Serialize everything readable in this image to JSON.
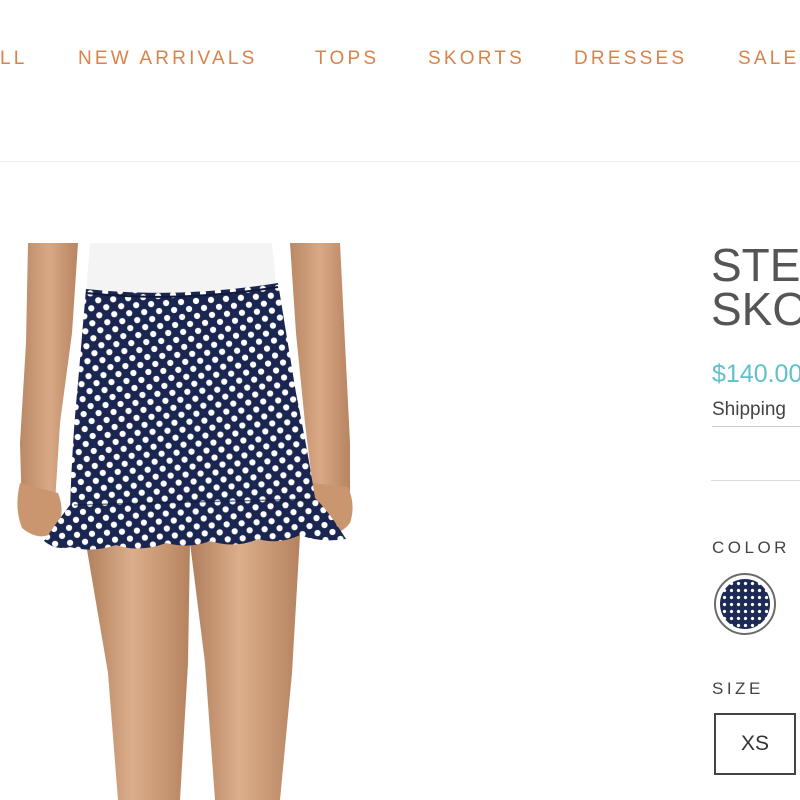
{
  "nav": {
    "items": [
      {
        "label": "LL"
      },
      {
        "label": "NEW ARRIVALS"
      },
      {
        "label": "TOPS"
      },
      {
        "label": "SKORTS"
      },
      {
        "label": "DRESSES"
      },
      {
        "label": "SALE"
      }
    ],
    "accent_color": "#d9824a"
  },
  "product": {
    "title_line1": "STE",
    "title_line2": "SKO",
    "price": "$140.00",
    "shipping_text": "Shipping",
    "price_color": "#5fc1c9",
    "image": {
      "description_icon": "navy-polka-dot-ruffle-skort-photo"
    },
    "color": {
      "label": "COLOR",
      "swatch_color": "#1c2a55",
      "swatch_icon": "navy-polka-dot-swatch"
    },
    "size": {
      "label": "SIZE",
      "options": [
        {
          "label": "XS"
        }
      ]
    }
  }
}
